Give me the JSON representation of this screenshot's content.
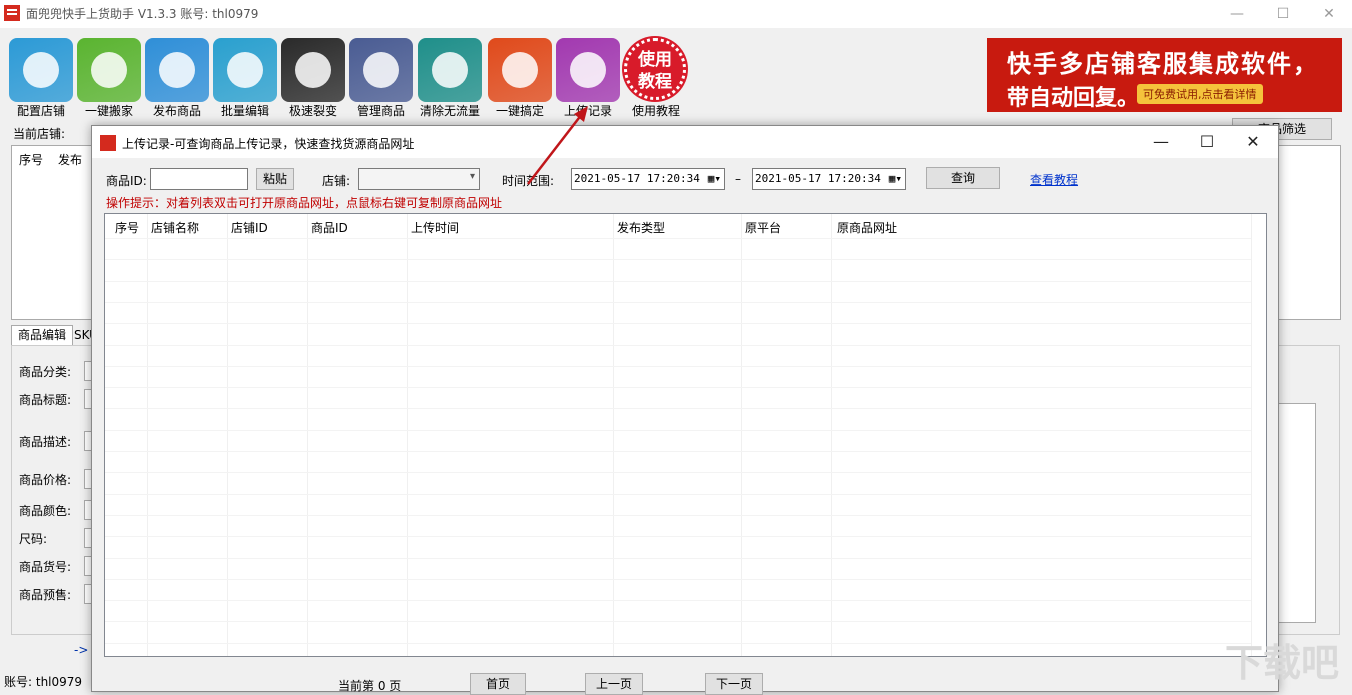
{
  "app": {
    "title": "面兜兜快手上货助手 V1.3.3   账号: thl0979",
    "window_controls": [
      "—",
      "☐",
      "✕"
    ]
  },
  "toolbar": [
    {
      "label": "配置店铺",
      "icon": "tools-icon",
      "color": "#2c9ad6"
    },
    {
      "label": "一键搬家",
      "icon": "download-cloud-icon",
      "color": "#5ab430"
    },
    {
      "label": "发布商品",
      "icon": "upload-cloud-icon",
      "color": "#2f8fd8"
    },
    {
      "label": "批量编辑",
      "icon": "notepad-icon",
      "color": "#2aa0cf"
    },
    {
      "label": "极速裂变",
      "icon": "layers-icon",
      "color": "#2a2a2a"
    },
    {
      "label": "管理商品",
      "icon": "gear-icon",
      "color": "#4a5c93"
    },
    {
      "label": "清除无流量",
      "icon": "forbidden-icon",
      "color": "#1f8f8a"
    },
    {
      "label": "一键搞定",
      "icon": "tag-icon",
      "color": "#e04a1b"
    },
    {
      "label": "上传记录",
      "icon": "bookmark-icon",
      "color": "#a239b0"
    },
    {
      "label": "使用教程",
      "icon": "tutorial-badge-icon",
      "color": "#d81b2a",
      "badge": "使用教程"
    }
  ],
  "banner": {
    "line1": "快手多店铺客服集成软件，",
    "line2": "带自动回复。",
    "hint": "可免费试用,点击看详情"
  },
  "background": {
    "current_shop_label": "当前店铺:",
    "filter_button": "商品筛选",
    "table_headers": [
      "序号",
      "发布"
    ],
    "tabs": [
      "商品编辑",
      "SKU"
    ],
    "form_labels": [
      "商品分类:",
      "商品标题:",
      "商品描述:",
      "商品价格:",
      "商品颜色:",
      "尺码:",
      "商品货号:",
      "商品预售:"
    ],
    "link_prefix": "->",
    "status_account": "账号: thl0979"
  },
  "dialog": {
    "title": "上传记录-可查询商品上传记录，快速查找货源商品网址",
    "product_id_label": "商品ID:",
    "product_id_value": "",
    "paste_button": "粘贴",
    "shop_label": "店铺:",
    "shop_value": "",
    "time_range_label": "时间范围:",
    "date_from": "2021-05-17 17:20:34",
    "date_to": "2021-05-17 17:20:34",
    "date_separator": "–",
    "query_button": "查询",
    "tutorial_link": "查看教程",
    "hint": "操作提示：对着列表双击可打开原商品网址，点鼠标右键可复制原商品网址",
    "columns": [
      "序号",
      "店铺名称",
      "店铺ID",
      "商品ID",
      "上传时间",
      "发布类型",
      "原平台",
      "原商品网址"
    ],
    "pager": {
      "current": "当前第 0 页",
      "first": "首页",
      "prev": "上一页",
      "next": "下一页"
    }
  },
  "watermark": "下载吧"
}
